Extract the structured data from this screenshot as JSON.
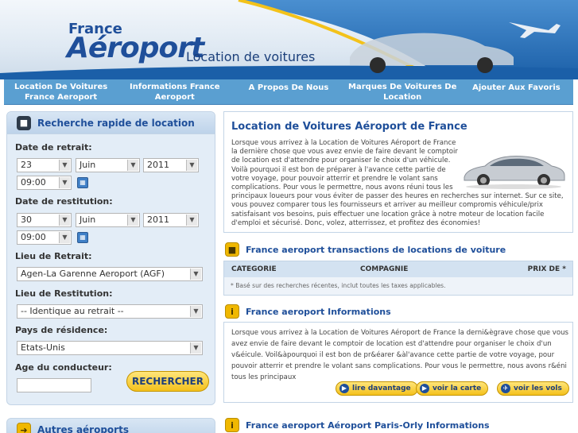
{
  "header": {
    "logo_top": "France",
    "logo_main": "Aéroport",
    "logo_sub": "Location de voitures"
  },
  "nav": {
    "items": [
      {
        "label": "Location De Voitures France Aeroport"
      },
      {
        "label": "Informations France Aeroport"
      },
      {
        "label": "A Propos De Nous"
      },
      {
        "label": "Marques De Voitures De Location"
      },
      {
        "label": "Ajouter Aux Favoris"
      }
    ]
  },
  "search": {
    "title": "Recherche rapide de location",
    "pickup_label": "Date de retrait:",
    "pickup_day": "23",
    "pickup_month": "Juin",
    "pickup_year": "2011",
    "pickup_time": "09:00",
    "return_label": "Date de restitution:",
    "return_day": "30",
    "return_month": "Juin",
    "return_year": "2011",
    "return_time": "09:00",
    "pickup_location_label": "Lieu de Retrait:",
    "pickup_location": "Agen-La Garenne Aeroport (AGF)",
    "return_location_label": "Lieu de Restitution:",
    "return_location": "-- Identique au retrait --",
    "country_label": "Pays de résidence:",
    "country": "Etats-Unis",
    "age_label": "Age du conducteur:",
    "age_value": "",
    "button": "RECHERCHER"
  },
  "other_airports": {
    "title": "Autres aéroports"
  },
  "main": {
    "title": "Location de Voitures Aéroport de France",
    "intro": "Lorsque vous arrivez à la Location de Voitures Aéroport de France la dernière chose que vous avez envie de faire devant le comptoir de location est d'attendre pour organiser le choix d'un véhicule. Voilà pourquoi il est bon de préparer à l'avance cette partie de votre voyage, pour pouvoir atterrir et prendre le volant sans complications. Pour vous le permettre, nous avons réuni tous les principaux loueurs pour vous éviter de passer des heures en recherches sur internet. Sur ce site, vous pouvez comparer tous les fournisseurs et arriver au meilleur compromis véhicule/prix satisfaisant vos besoins, puis effectuer une location grâce à notre moteur de location facile d'emploi et sécurisé. Donc, volez, atterrissez, et profitez des économies!"
  },
  "transactions": {
    "title": "France aeroport transactions de locations de voiture",
    "col_category": "CATEGORIE",
    "col_company": "COMPAGNIE",
    "col_price": "PRIX DE *",
    "note": "* Basé sur des recherches récentes, inclut toutes les taxes applicables."
  },
  "informations": {
    "title": "France aeroport Informations",
    "text": "Lorsque vous arrivez à la Location de Voitures Aéroport de France la derni&ègrave chose que vous avez envie de faire devant le comptoir de location est d'attendre pour organiser le choix d'un v&éicule. Voil&àpourquoi il est bon de pr&éarer &àl'avance cette partie de votre voyage, pour pouvoir atterrir et prendre le volant sans complications. Pour vous le permettre, nous avons r&éni tous les principaux",
    "btn_more": "lire davantage",
    "btn_map": "voir la carte",
    "btn_flights": "voir les vols"
  },
  "orly": {
    "title": "France aeroport Aéroport Paris-Orly Informations"
  }
}
